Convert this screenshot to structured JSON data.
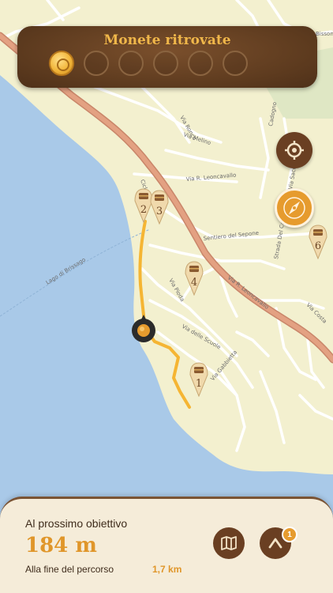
{
  "coins_panel": {
    "title": "Monete ritrovate",
    "found_count": 1,
    "total_count": 6
  },
  "map": {
    "streets": {
      "via_r_leoncavallo_upper": "Via R. Leoncavallo",
      "via_r_leoncavallo_lower": "Via R. Leoncavallo",
      "via_melino": "Via Melino",
      "sentiero_del_sepone": "Sentiero del Sepone",
      "via_piodo": "Via Pioda",
      "via_delle_scuole": "Via delle Scuole",
      "via_gabbietta": "Via Gabbietta",
      "strada_del_calvario": "Strada Del Calvario",
      "via_costa": "Via Costa",
      "cadogno": "Cadogno",
      "via_sacro_monte": "Via Sacro M.",
      "via_ronco": "Via Ronco",
      "ciclopista": "Ciclopista",
      "bellinzona": "Bissone",
      "lake_label": "Lago di Brissago"
    },
    "markers": [
      {
        "number": "1"
      },
      {
        "number": "2"
      },
      {
        "number": "3"
      },
      {
        "number": "4"
      },
      {
        "number": "6"
      }
    ],
    "colors": {
      "water": "#a9c9e8",
      "land": "#f3f0cf",
      "main_road": "#e3a182",
      "route": "#f5b533",
      "brown": "#6a3f22",
      "orange": "#e69b2e"
    }
  },
  "bottom_panel": {
    "next_label": "Al prossimo obiettivo",
    "distance": "184 m",
    "route_end_label": "Alla fine del percorso",
    "route_end_value": "1,7 km",
    "badge_count": "1"
  }
}
